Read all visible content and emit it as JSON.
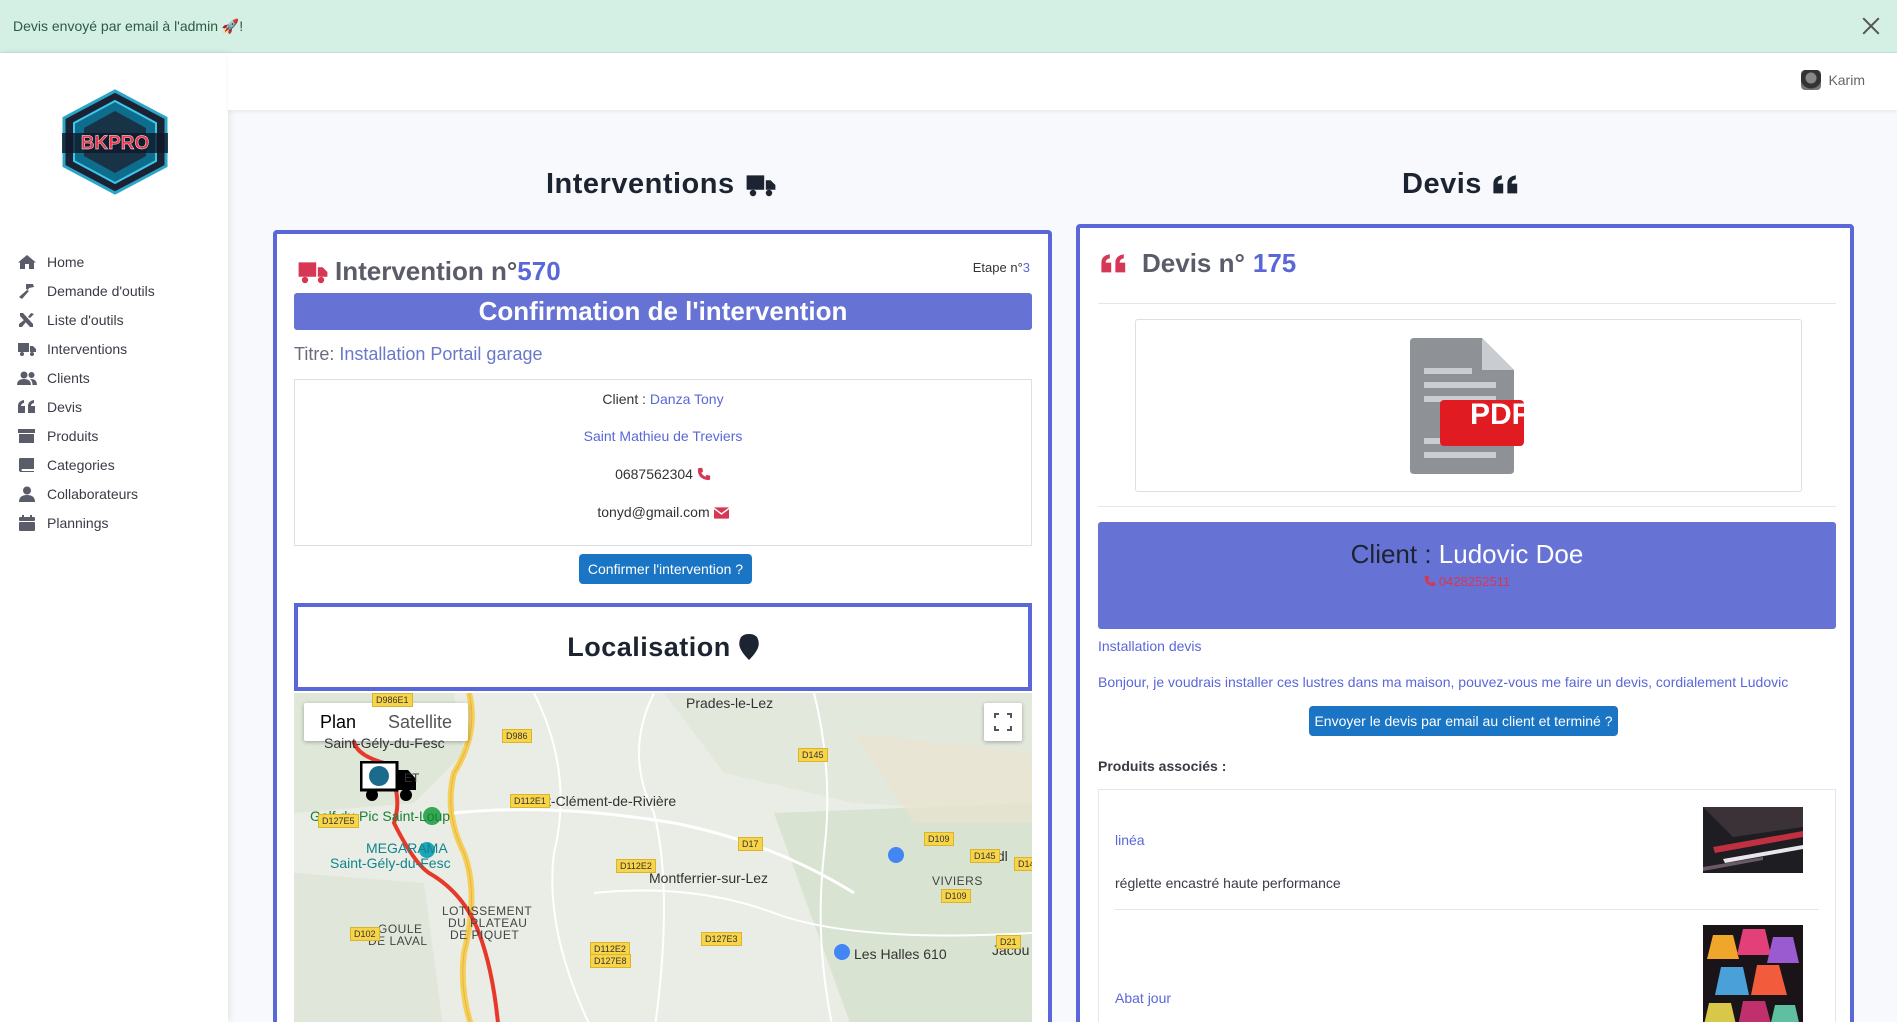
{
  "alert": {
    "message": "Devis envoyé par email à l'admin 🚀!"
  },
  "sidebar": {
    "logo_text": "BKPRO",
    "items": [
      {
        "label": "Home",
        "icon": "home-icon"
      },
      {
        "label": "Demande d'outils",
        "icon": "hammer-icon"
      },
      {
        "label": "Liste d'outils",
        "icon": "tools-icon"
      },
      {
        "label": "Interventions",
        "icon": "truck-icon"
      },
      {
        "label": "Clients",
        "icon": "users-icon"
      },
      {
        "label": "Devis",
        "icon": "quote-icon"
      },
      {
        "label": "Produits",
        "icon": "archive-icon"
      },
      {
        "label": "Categories",
        "icon": "book-icon"
      },
      {
        "label": "Collaborateurs",
        "icon": "user-icon"
      },
      {
        "label": "Plannings",
        "icon": "calendar-icon"
      }
    ]
  },
  "topbar": {
    "username": "Karim"
  },
  "interventions": {
    "section_title": "Interventions",
    "heading_prefix": "Intervention n°",
    "number": "570",
    "etape_label": "Etape n°",
    "etape_value": "3",
    "banner": "Confirmation de l'intervention",
    "titre_label": "Titre:",
    "titre_value": "Installation Portail garage",
    "client_label": "Client :",
    "client_name": "Danza Tony",
    "city": "Saint Mathieu de Treviers",
    "phone": "0687562304",
    "email": "tonyd@gmail.com",
    "confirm_button": "Confirmer l'intervention ?",
    "localisation_title": "Localisation"
  },
  "map": {
    "plan_label": "Plan",
    "satellite_label": "Satellite",
    "places": {
      "prades": "Prades-le-Lez",
      "saint_gely": "Saint-Gély-du-Fesc",
      "saint_clement": "Saint-Clément-de-Rivière",
      "golf": "Golf du Pic Saint-Loup",
      "megarama1": "MEGARAMA",
      "megarama2": "Saint-Gély-du-Fesc",
      "montferrier": "Montferrier-sur-Lez",
      "viviers": "VIVIERS",
      "lotissement1": "LOTISSEMENT",
      "lotissement2": "DU PLATEAU",
      "lotissement3": "DE PIQUET",
      "goule1": "GOULE",
      "goule2": "DE LAVAL",
      "lidl": "Lidl",
      "halles": "Les Halles 610",
      "jacou": "Jacou",
      "fesc_partial": "ET"
    },
    "roads": [
      "D986E1",
      "D986",
      "D145",
      "D112E1",
      "D127E5",
      "D17",
      "D109",
      "D145",
      "D112E2",
      "D127E3",
      "D109",
      "D14",
      "D102",
      "D112E2",
      "D127E8",
      "D21",
      "D145",
      "D127E5"
    ]
  },
  "devis": {
    "section_title": "Devis",
    "heading_prefix": "Devis n°",
    "number": "175",
    "pdf_label": "PDF",
    "client_label": "Client :",
    "client_name": "Ludovic Doe",
    "client_phone": "0428252511",
    "install_title": "Installation devis",
    "message": "Bonjour, je voudrais installer ces lustres dans ma maison, pouvez-vous me faire un devis, cordialement Ludovic",
    "send_button": "Envoyer le devis par email au client et terminé ?",
    "products_title": "Produits associés :",
    "products": [
      {
        "name": "linéa",
        "description": "réglette encastré haute performance"
      },
      {
        "name": "Abat jour",
        "description": ""
      }
    ]
  },
  "colors": {
    "accent": "#5a67d8",
    "danger": "#d63755",
    "button": "#1a75c4",
    "alert_bg": "#d4efe4"
  }
}
